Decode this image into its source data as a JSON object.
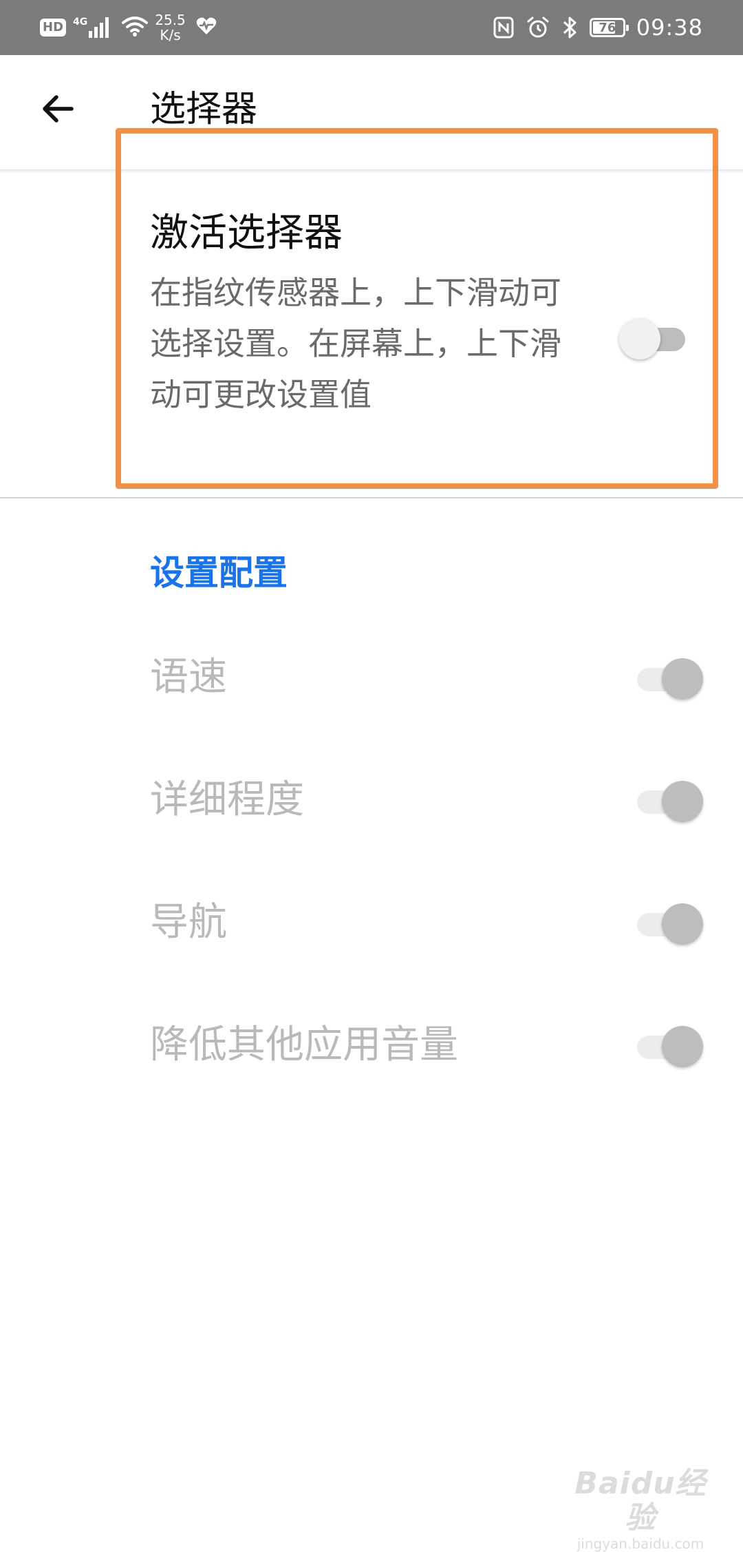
{
  "status_bar": {
    "hd_badge": "HD",
    "network_type": "4G",
    "speed_value": "25.5",
    "speed_unit": "K/s",
    "battery": "76",
    "battery_level_percent": 76,
    "time": "09:38",
    "icons": [
      "signal-bars-icon",
      "wifi-icon",
      "health-heart-icon",
      "nfc-icon",
      "alarm-icon",
      "bluetooth-icon",
      "battery-icon"
    ]
  },
  "toolbar": {
    "title": "选择器",
    "back_icon": "back-arrow-icon"
  },
  "activate": {
    "title": "激活选择器",
    "description": "在指纹传感器上，上下滑动可选择设置。在屏幕上，上下滑动可更改设置值",
    "switch_state": "off"
  },
  "section": {
    "header": "设置配置",
    "items": [
      {
        "label": "语速",
        "switch_state": "on-disabled"
      },
      {
        "label": "详细程度",
        "switch_state": "on-disabled"
      },
      {
        "label": "导航",
        "switch_state": "on-disabled"
      },
      {
        "label": "降低其他应用音量",
        "switch_state": "on-disabled"
      }
    ]
  },
  "watermark": {
    "logo": "Baidu经验",
    "url": "jingyan.baidu.com"
  },
  "colors": {
    "status_bar_bg": "#7b7b7b",
    "accent": "#1a73e8",
    "highlight_box": "#f0914a",
    "disabled_text": "#b9b9b9"
  }
}
